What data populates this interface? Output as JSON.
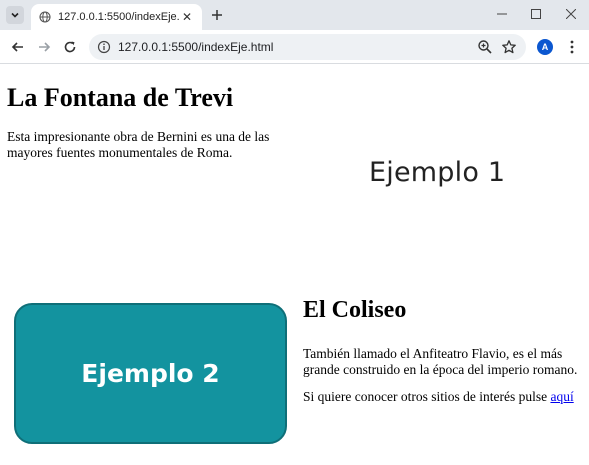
{
  "browser": {
    "tab_title": "127.0.0.1:5500/indexEje.html",
    "url": "127.0.0.1:5500/indexEje.html",
    "avatar_letter": "A",
    "accent_color": "#0b57d0"
  },
  "page": {
    "trevi": {
      "heading": "La Fontana de Trevi",
      "paragraph": "Esta impresionante obra de Bernini es una de las mayores fuentes monumentales de Roma."
    },
    "example1_label": "Ejemplo 1",
    "example2": {
      "label": "Ejemplo 2",
      "color": "#13939f"
    },
    "coliseo": {
      "heading": "El Coliseo",
      "paragraph": "También llamado el Anfiteatro Flavio, es el más grande construido en la época del imperio romano.",
      "link_sentence": "Si quiere conocer otros sitios de interés pulse ",
      "link_text": "aquí"
    }
  }
}
